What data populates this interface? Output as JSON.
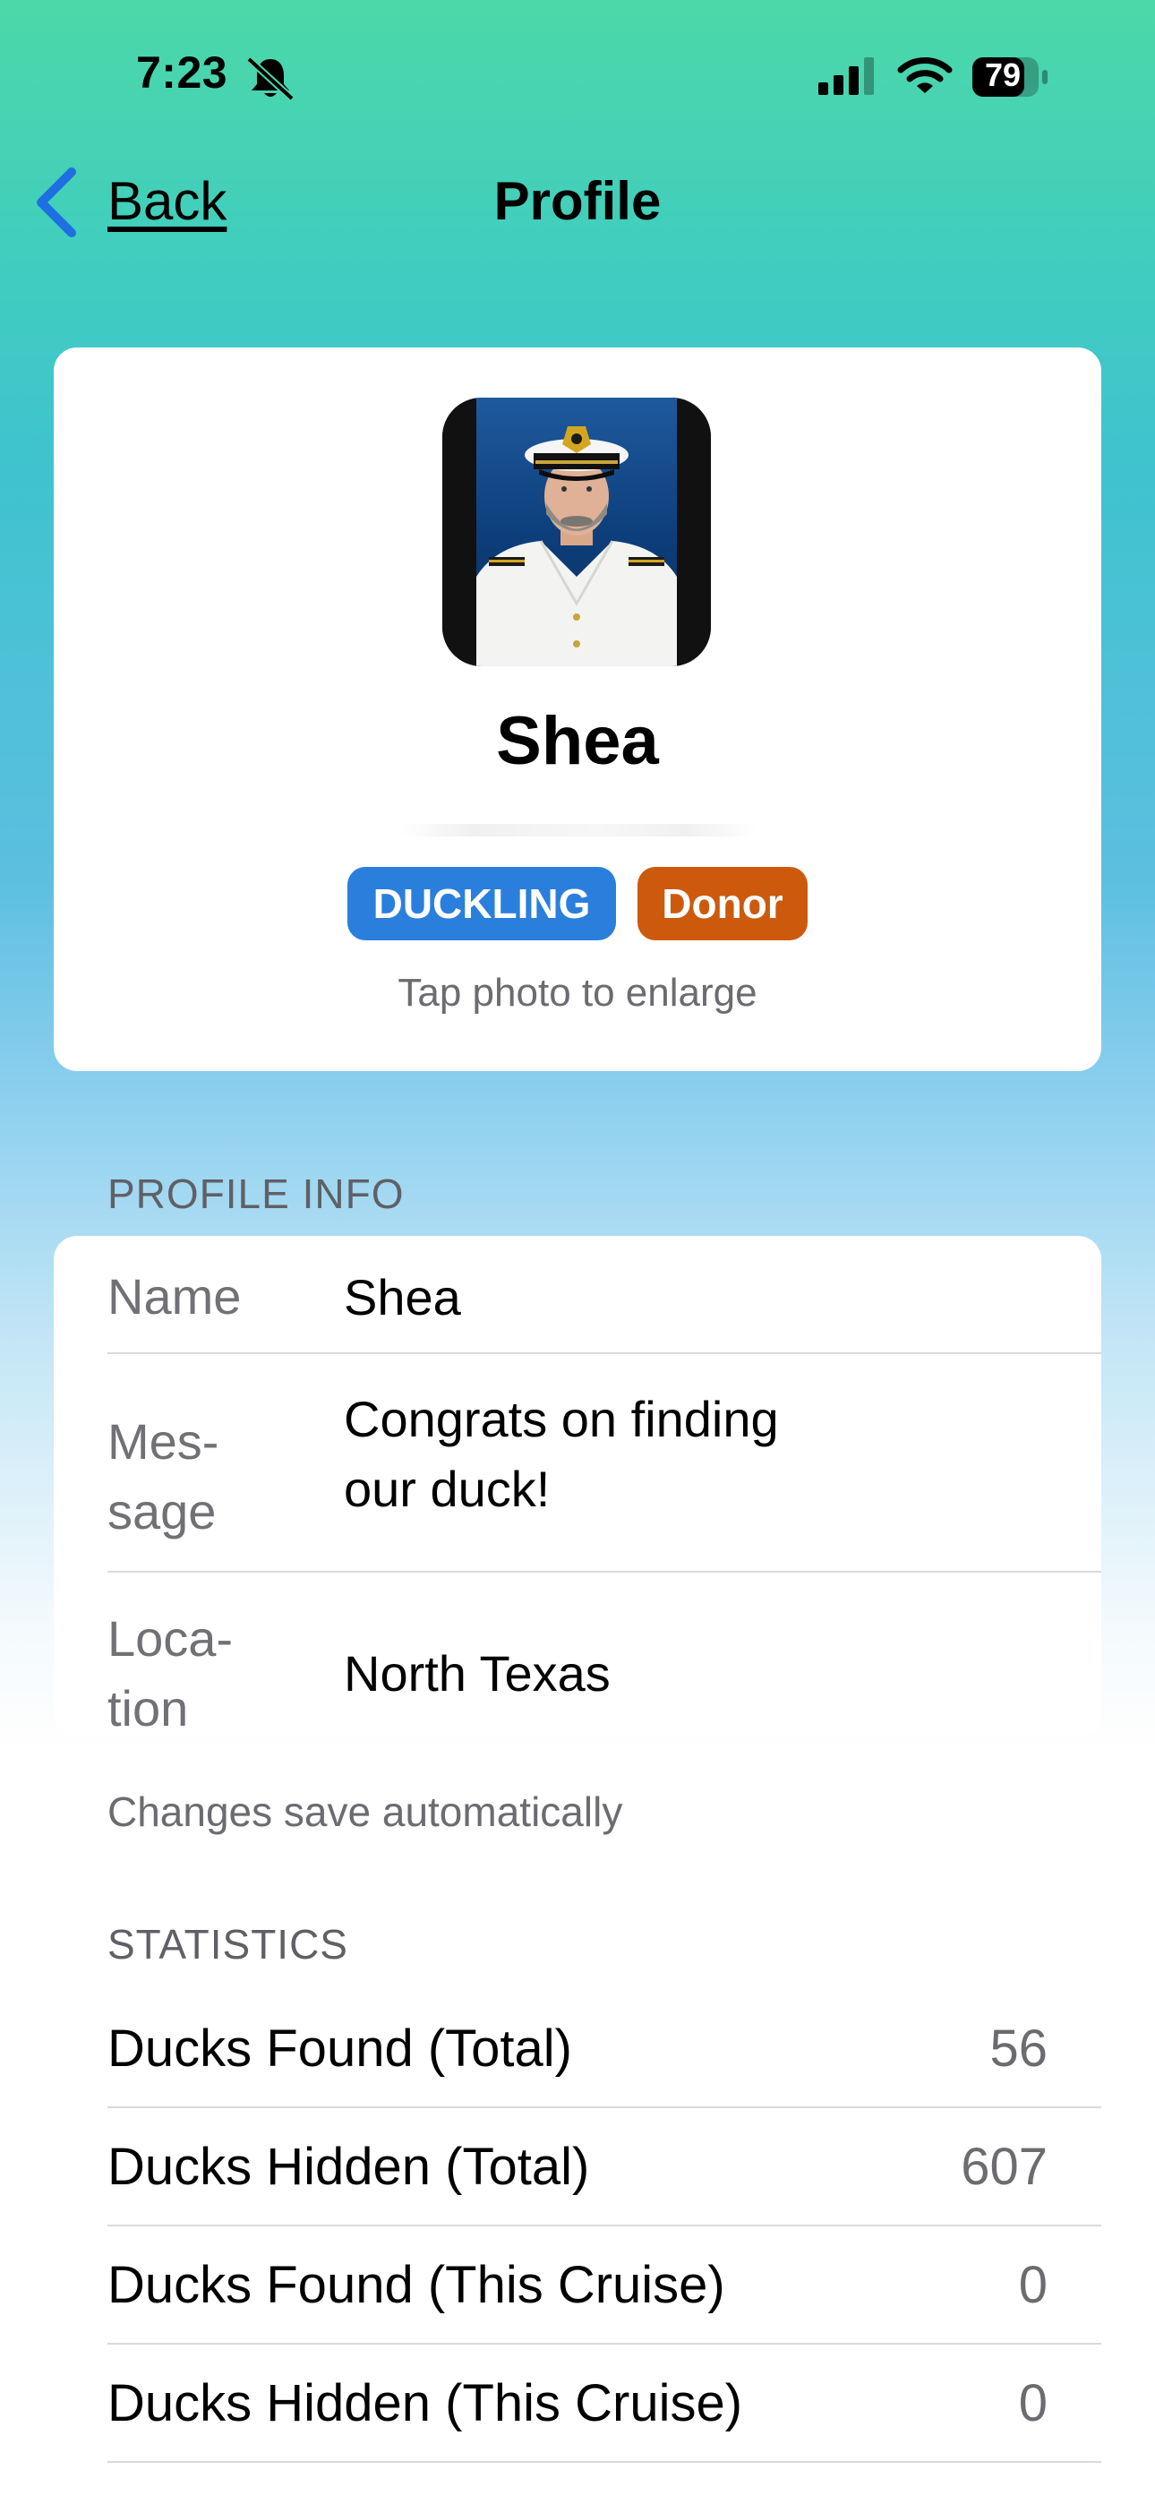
{
  "status_bar": {
    "time": "7:23",
    "battery": "79"
  },
  "nav": {
    "back_label": "Back",
    "title": "Profile"
  },
  "profile_card": {
    "name": "Shea",
    "badges": [
      "DUCKLING",
      "Donor"
    ],
    "hint": "Tap photo to enlarge"
  },
  "profile_info": {
    "header": "PROFILE INFO",
    "rows": [
      {
        "label": "Name",
        "value": "Shea"
      },
      {
        "label_lines": [
          "Mes-",
          "sage"
        ],
        "value_lines": [
          "Congrats on finding",
          "our duck!"
        ]
      },
      {
        "label_lines": [
          "Loca-",
          "tion"
        ],
        "value": "North Texas"
      }
    ],
    "footnote": "Changes save automatically"
  },
  "statistics": {
    "header": "STATISTICS",
    "rows": [
      {
        "label": "Ducks Found (Total)",
        "value": "56"
      },
      {
        "label": "Ducks Hidden (Total)",
        "value": "607"
      },
      {
        "label": "Ducks Found (This Cruise)",
        "value": "0"
      },
      {
        "label": "Ducks Hidden (This Cruise)",
        "value": "0"
      }
    ]
  },
  "colors": {
    "duckling_badge": "#2b7fdc",
    "donor_badge": "#cd5a0c",
    "nav_tint": "#1e6fe0"
  },
  "icons": [
    "bell-slash-icon",
    "signal-icon",
    "wifi-icon",
    "battery-icon",
    "chevron-left-icon"
  ]
}
